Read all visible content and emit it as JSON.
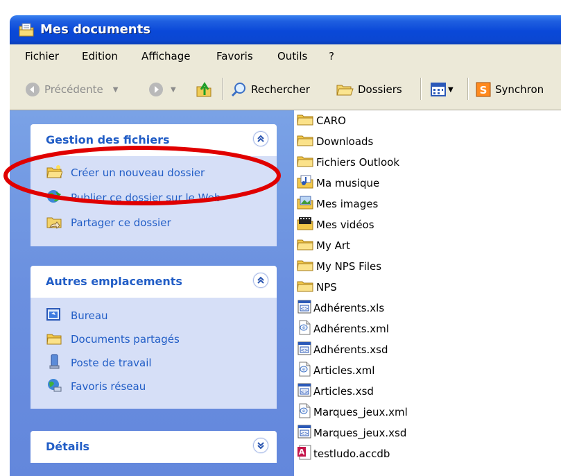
{
  "window": {
    "title": "Mes documents"
  },
  "menu": [
    "Fichier",
    "Edition",
    "Affichage",
    "Favoris",
    "Outils",
    "?"
  ],
  "toolbar": {
    "back": "Précédente",
    "search": "Rechercher",
    "folders": "Dossiers",
    "sync": "Synchron"
  },
  "tasks": {
    "file_management": {
      "title": "Gestion des fichiers",
      "items": [
        "Créer un nouveau dossier",
        "Publier ce dossier sur le Web",
        "Partager ce dossier"
      ]
    },
    "other_places": {
      "title": "Autres emplacements",
      "items": [
        "Bureau",
        "Documents partagés",
        "Poste de travail",
        "Favoris réseau"
      ]
    },
    "details": {
      "title": "Détails"
    }
  },
  "files": [
    {
      "name": "CARO",
      "icon": "folder-icon"
    },
    {
      "name": "Downloads",
      "icon": "folder-icon"
    },
    {
      "name": "Fichiers Outlook",
      "icon": "folder-icon"
    },
    {
      "name": "Ma musique",
      "icon": "music-folder-icon"
    },
    {
      "name": "Mes images",
      "icon": "pictures-folder-icon"
    },
    {
      "name": "Mes vidéos",
      "icon": "video-folder-icon"
    },
    {
      "name": "My Art",
      "icon": "folder-icon"
    },
    {
      "name": "My NPS Files",
      "icon": "folder-icon"
    },
    {
      "name": "NPS",
      "icon": "folder-icon"
    },
    {
      "name": "Adhérents.xls",
      "icon": "xsd-file-icon"
    },
    {
      "name": "Adhérents.xml",
      "icon": "xml-file-icon"
    },
    {
      "name": "Adhérents.xsd",
      "icon": "xsd-file-icon"
    },
    {
      "name": "Articles.xml",
      "icon": "xml-file-icon"
    },
    {
      "name": "Articles.xsd",
      "icon": "xsd-file-icon"
    },
    {
      "name": "Marques_jeux.xml",
      "icon": "xml-file-icon"
    },
    {
      "name": "Marques_jeux.xsd",
      "icon": "xsd-file-icon"
    },
    {
      "name": "testludo.accdb",
      "icon": "access-file-icon"
    }
  ],
  "annotation_color": "#e00000"
}
